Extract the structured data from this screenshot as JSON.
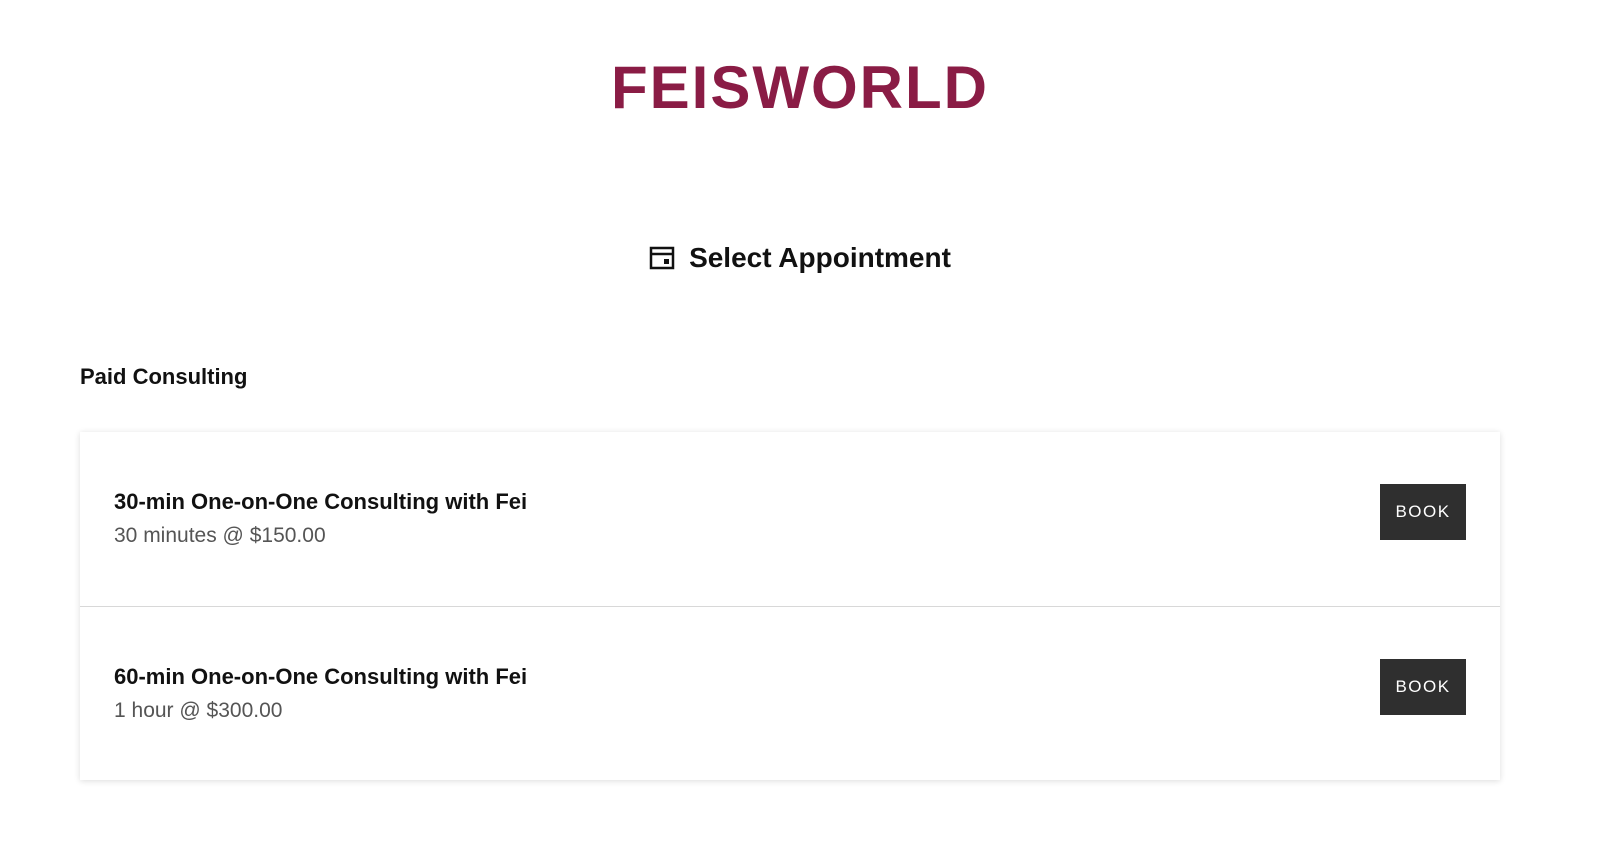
{
  "brand": {
    "logo_text": "FEISWORLD",
    "logo_color": "#8a1c45"
  },
  "header": {
    "icon": "calendar-icon",
    "title": "Select Appointment"
  },
  "group": {
    "title": "Paid Consulting"
  },
  "appointments": [
    {
      "name": "30-min One-on-One Consulting with Fei",
      "detail": "30 minutes @ $150.00",
      "button_label": "BOOK"
    },
    {
      "name": "60-min One-on-One Consulting with Fei",
      "detail": "1 hour @ $300.00",
      "button_label": "BOOK"
    }
  ],
  "colors": {
    "button_bg": "#2f2f2f",
    "button_text": "#ffffff"
  }
}
